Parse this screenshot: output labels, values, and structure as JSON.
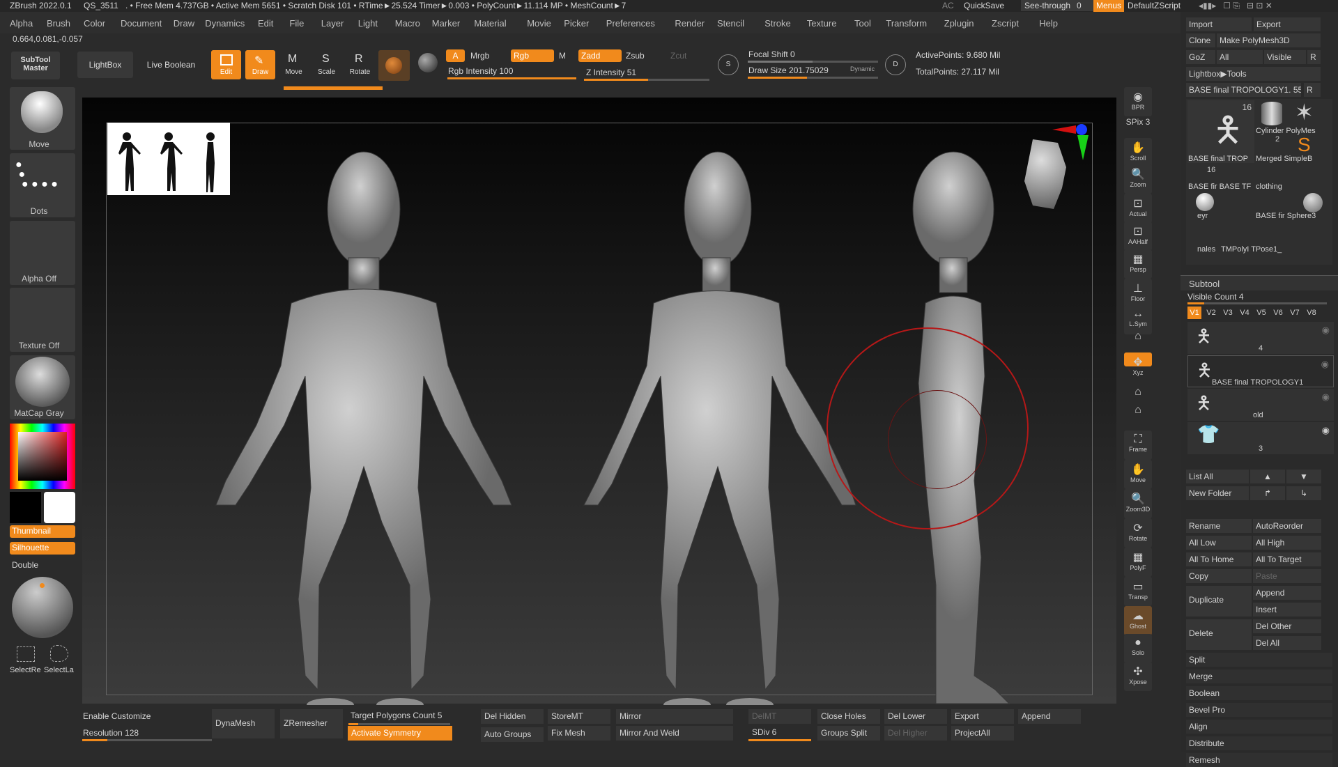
{
  "titlebar": {
    "app": "ZBrush 2022.0.1",
    "doc": "QS_3511",
    "stats": ". • Free Mem 4.737GB • Active Mem 5651 • Scratch Disk 101 • RTime►25.524 Timer►0.003 • PolyCount►11.114 MP • MeshCount►7",
    "ac": "AC",
    "quicksave": "QuickSave",
    "seethrough": "See-through",
    "seethrough_val": "0",
    "menus": "Menus",
    "script": "DefaultZScript"
  },
  "menu": [
    "Alpha",
    "Brush",
    "Color",
    "Document",
    "Draw",
    "Dynamics",
    "Edit",
    "File",
    "Layer",
    "Light",
    "Macro",
    "Marker",
    "Material",
    "Movie",
    "Picker",
    "Preferences",
    "Render",
    "Stencil",
    "Stroke",
    "Texture",
    "Tool",
    "Transform",
    "Zplugin",
    "Zscript",
    "Help"
  ],
  "coords": "0.664,0.081,-0.057",
  "toolbar": {
    "subtool_master": "SubTool Master",
    "lightbox": "LightBox",
    "live_boolean": "Live Boolean",
    "edit": "Edit",
    "draw": "Draw",
    "move": "Move",
    "scale": "Scale",
    "rotate": "Rotate",
    "a": "A",
    "mrgb": "Mrgb",
    "rgb": "Rgb",
    "m": "M",
    "zadd": "Zadd",
    "zsub": "Zsub",
    "zcut": "Zcut",
    "rgb_intensity": "Rgb Intensity 100",
    "z_intensity": "Z Intensity 51",
    "focal_shift": "Focal Shift 0",
    "draw_size": "Draw Size 201.75029",
    "dynamic": "Dynamic",
    "active_points": "ActivePoints: 9.680 Mil",
    "total_points": "TotalPoints: 27.117 Mil",
    "s": "S",
    "d": "D"
  },
  "leftshelf": {
    "move": "Move",
    "dots": "Dots",
    "alpha_off": "Alpha Off",
    "texture_off": "Texture Off",
    "matcap": "MatCap Gray",
    "thumbnail": "Thumbnail",
    "silhouette": "Silhouette",
    "double": "Double",
    "selectrect": "SelectRe",
    "selectlasso": "SelectLa"
  },
  "rightshelf": [
    "BPR",
    "SPix 3",
    "Scroll",
    "Zoom",
    "Actual",
    "AAHalf",
    "Persp",
    "Floor",
    "L.Sym",
    "",
    "Xyz",
    "",
    "",
    "Frame",
    "Move",
    "Zoom3D",
    "Rotate",
    "PolyF",
    "Transp",
    "Ghost",
    "Solo",
    "Xpose"
  ],
  "tray": {
    "import": "Import",
    "export": "Export",
    "clone": "Clone",
    "make_polymesh": "Make PolyMesh3D",
    "goz": "GoZ",
    "all": "All",
    "visible": "Visible",
    "r": "R",
    "lightbox_tools": "Lightbox▶Tools",
    "current_tool": "BASE final TROPOLOGY1. 55",
    "tools": [
      "BASE final TROP",
      "Cylinder PolyMes",
      "Merged SimpleB",
      "BASE fir BASE TF",
      "clothing",
      "eyr",
      "BASE fir Sphere3",
      "nales",
      "TMPolyI TPose1_"
    ],
    "counts": [
      "16",
      "2",
      "16"
    ],
    "subtool": "Subtool",
    "visible_count": "Visible Count 4",
    "vtabs": [
      "V1",
      "V2",
      "V3",
      "V4",
      "V5",
      "V6",
      "V7",
      "V8"
    ],
    "subtools": [
      "4",
      "BASE final TROPOLOGY1",
      "old",
      "3"
    ],
    "list_all": "List All",
    "new_folder": "New Folder",
    "rename": "Rename",
    "autoreorder": "AutoReorder",
    "all_low": "All Low",
    "all_high": "All High",
    "all_to_home": "All To Home",
    "all_to_target": "All To Target",
    "copy": "Copy",
    "paste": "Paste",
    "duplicate": "Duplicate",
    "append": "Append",
    "insert": "Insert",
    "delete": "Delete",
    "del_other": "Del Other",
    "del_all": "Del All",
    "split": "Split",
    "merge": "Merge",
    "boolean": "Boolean",
    "bevel_pro": "Bevel Pro",
    "align": "Align",
    "distribute": "Distribute",
    "remesh": "Remesh"
  },
  "bottom": {
    "enable_customize": "Enable Customize",
    "resolution": "Resolution 128",
    "dynamesh": "DynaMesh",
    "zremesher": "ZRemesher",
    "target_polys": "Target Polygons Count 5",
    "activate_symmetry": "Activate Symmetry",
    "del_hidden": "Del Hidden",
    "auto_groups": "Auto Groups",
    "storemt": "StoreMT",
    "fix_mesh": "Fix Mesh",
    "mirror": "Mirror",
    "mirror_weld": "Mirror And Weld",
    "delmt": "DelMT",
    "sdiv": "SDiv 6",
    "close_holes": "Close Holes",
    "groups_split": "Groups Split",
    "del_lower": "Del Lower",
    "del_higher": "Del Higher",
    "export": "Export",
    "projectall": "ProjectAll",
    "append": "Append"
  }
}
